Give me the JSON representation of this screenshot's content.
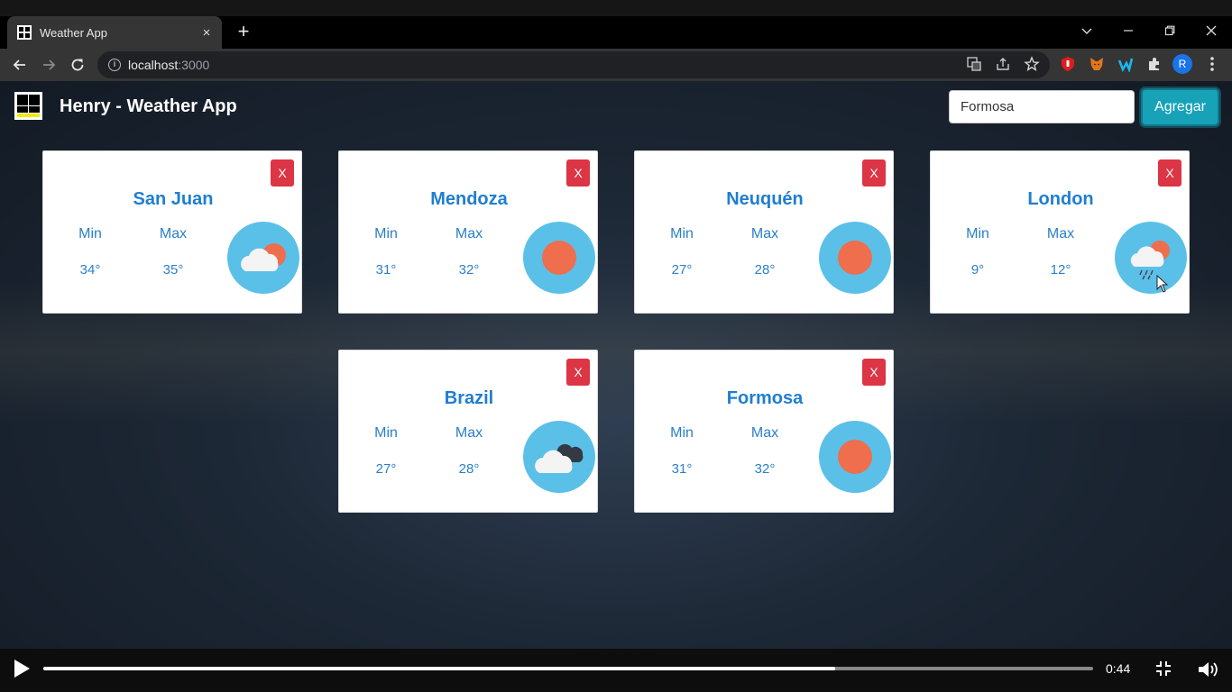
{
  "browser": {
    "tab_title": "Weather App",
    "tab_close": "×",
    "new_tab": "+",
    "url_host": "localhost",
    "url_port": ":3000",
    "profile_initial": "R"
  },
  "header": {
    "title": "Henry - Weather App",
    "search_value": "Formosa",
    "add_label": "Agregar"
  },
  "cards": [
    {
      "city": "San Juan",
      "min_label": "Min",
      "max_label": "Max",
      "min": "34°",
      "max": "35°",
      "icon": "partly-cloudy-icon",
      "close": "X"
    },
    {
      "city": "Mendoza",
      "min_label": "Min",
      "max_label": "Max",
      "min": "31°",
      "max": "32°",
      "icon": "sun-icon",
      "close": "X"
    },
    {
      "city": "Neuquén",
      "min_label": "Min",
      "max_label": "Max",
      "min": "27°",
      "max": "28°",
      "icon": "sun-icon",
      "close": "X"
    },
    {
      "city": "London",
      "min_label": "Min",
      "max_label": "Max",
      "min": "9°",
      "max": "12°",
      "icon": "rain-icon",
      "close": "X"
    },
    {
      "city": "Brazil",
      "min_label": "Min",
      "max_label": "Max",
      "min": "27°",
      "max": "28°",
      "icon": "cloudy-icon",
      "close": "X"
    },
    {
      "city": "Formosa",
      "min_label": "Min",
      "max_label": "Max",
      "min": "31°",
      "max": "32°",
      "icon": "sun-icon",
      "close": "X"
    }
  ],
  "colors": {
    "city": "#1f7ed0",
    "close": "#dc3545",
    "add": "#17a2b8",
    "icon_bg": "#5bc0e8",
    "sun": "#ee6e4d"
  },
  "video": {
    "time": "0:44",
    "progress": 0.754
  }
}
